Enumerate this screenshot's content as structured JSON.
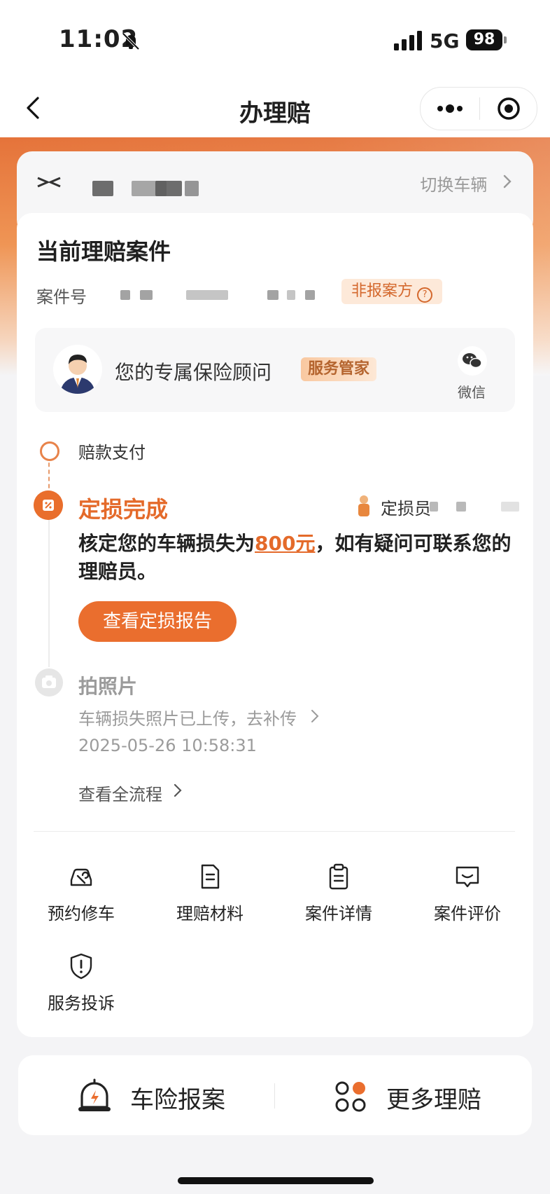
{
  "status_bar": {
    "time": "11:02",
    "network": "5G",
    "battery": "98"
  },
  "nav": {
    "title": "办理赔"
  },
  "vehicle": {
    "switch_label": "切换车辆"
  },
  "case": {
    "title": "当前理赔案件",
    "case_no_label": "案件号",
    "non_reporter_tag": "非报案方"
  },
  "advisor": {
    "text": "您的专属保险顾问",
    "badge": "服务管家",
    "wechat_label": "微信"
  },
  "timeline": {
    "payment": "赔款支付",
    "assessment_title": "定损完成",
    "assessor_label": "定损员",
    "assessment_desc_prefix": "核定您的车辆损失为",
    "assessment_amount": "800元",
    "assessment_desc_suffix": "，如有疑问可联系您的理赔员。",
    "report_button": "查看定损报告",
    "photo_title": "拍照片",
    "photo_desc": "车辆损失照片已上传，去补传",
    "photo_time": "2025-05-26 10:58:31",
    "full_flow": "查看全流程"
  },
  "actions": [
    {
      "label": "预约修车",
      "icon": "wrench-car-icon"
    },
    {
      "label": "理赔材料",
      "icon": "document-icon"
    },
    {
      "label": "案件详情",
      "icon": "clipboard-icon"
    },
    {
      "label": "案件评价",
      "icon": "comment-icon"
    },
    {
      "label": "服务投诉",
      "icon": "shield-alert-icon"
    }
  ],
  "bottom": {
    "report_label": "车险报案",
    "more_label": "更多理赔"
  },
  "colors": {
    "accent": "#ea6e2e",
    "accent_light": "#fde9d9"
  }
}
